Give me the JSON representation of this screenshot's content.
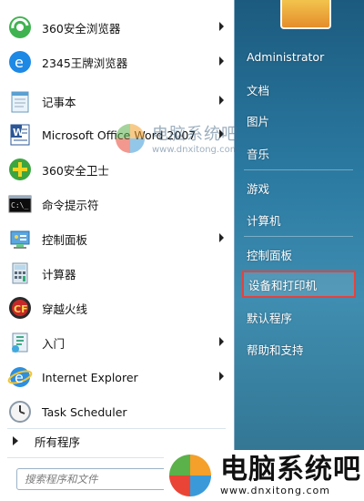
{
  "left_items": [
    {
      "label": "360安全浏览器",
      "arrow": true,
      "icon": "360-browser-icon"
    },
    {
      "label": "2345王牌浏览器",
      "arrow": true,
      "icon": "2345-browser-icon"
    },
    {
      "label": "记事本",
      "arrow": true,
      "icon": "notepad-icon"
    },
    {
      "label": "Microsoft Office Word 2007",
      "arrow": true,
      "icon": "word-icon"
    },
    {
      "label": "360安全卫士",
      "arrow": false,
      "icon": "360-guard-icon"
    },
    {
      "label": "命令提示符",
      "arrow": false,
      "icon": "cmd-icon"
    },
    {
      "label": "控制面板",
      "arrow": true,
      "icon": "control-panel-icon"
    },
    {
      "label": "计算器",
      "arrow": false,
      "icon": "calculator-icon"
    },
    {
      "label": "穿越火线",
      "arrow": false,
      "icon": "crossfire-icon"
    },
    {
      "label": "入门",
      "arrow": true,
      "icon": "getting-started-icon"
    },
    {
      "label": "Internet Explorer",
      "arrow": true,
      "icon": "ie-icon"
    },
    {
      "label": "Task Scheduler",
      "arrow": false,
      "icon": "task-scheduler-icon"
    }
  ],
  "all_programs_label": "所有程序",
  "search": {
    "placeholder": "搜索程序和文件"
  },
  "right_items": [
    {
      "label": "Administrator"
    },
    {
      "label": "文档"
    },
    {
      "label": "图片"
    },
    {
      "label": "音乐"
    },
    {
      "label": "游戏"
    },
    {
      "label": "计算机"
    },
    {
      "label": "控制面板"
    },
    {
      "label": "设备和打印机",
      "highlighted": true
    },
    {
      "label": "默认程序"
    },
    {
      "label": "帮助和支持"
    }
  ],
  "watermark": {
    "small_cn": "电脑系统吧",
    "small_url": "www.dnxitong.com",
    "large_cn": "电脑系统吧",
    "large_url": "www.dnxitong.com"
  },
  "colors": {
    "highlight_border": "#e8413b",
    "menu_bg": "#2b7aa2"
  }
}
